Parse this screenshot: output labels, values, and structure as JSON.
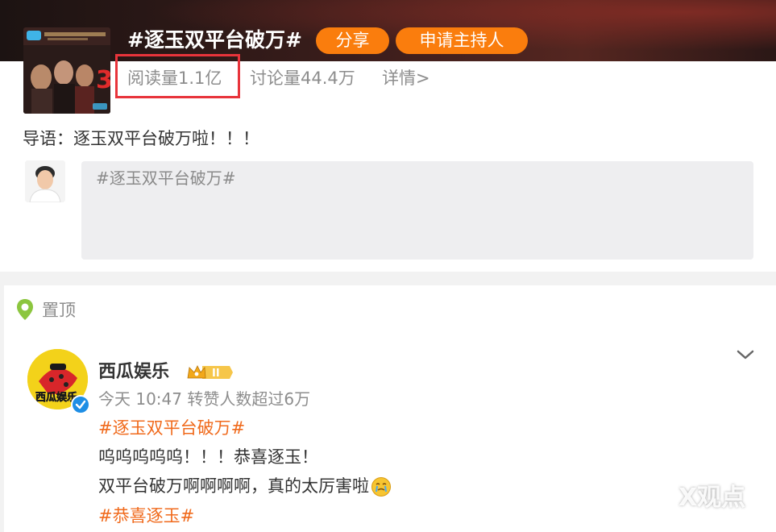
{
  "topic": {
    "title": "#逐玉双平台破万#",
    "share_label": "分享",
    "host_label": "申请主持人",
    "read_count": "阅读量1.1亿",
    "discuss_count": "讨论量44.4万",
    "detail_link": "详情>",
    "intro": "导语：逐玉双平台破万啦！！！",
    "composer_placeholder": "#逐玉双平台破万#"
  },
  "post": {
    "pinned_label": "置顶",
    "author": "西瓜娱乐",
    "meta": "今天 10:47 转赞人数超过6万",
    "lines": [
      "#逐玉双平台破万#",
      "呜呜呜呜呜！！！恭喜逐玉！",
      "双平台破万啊啊啊啊，真的太厉害啦",
      "#恭喜逐玉#"
    ]
  },
  "watermark": "X观点",
  "colors": {
    "accent_orange": "#fa7d0d",
    "link_orange": "#f06a1c",
    "highlight_red": "#e8343b",
    "verify_blue": "#1e8ee5"
  },
  "icons": [
    "pin-location-icon",
    "chevron-down-icon",
    "vip-crown-badge",
    "verified-icon",
    "crying-emoji-icon"
  ]
}
